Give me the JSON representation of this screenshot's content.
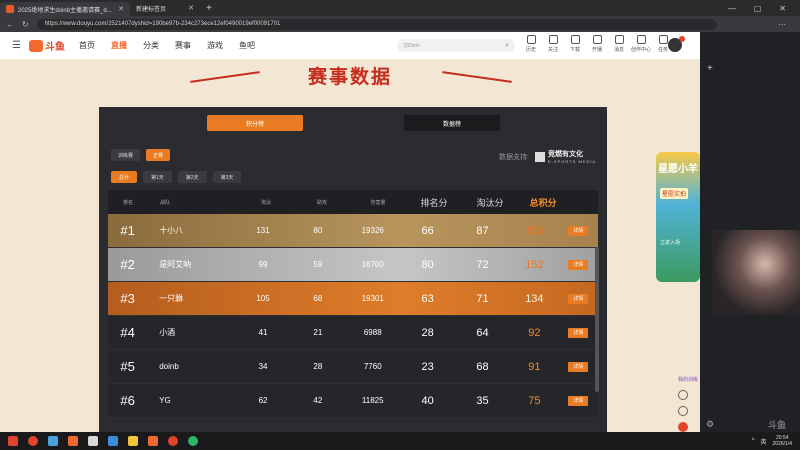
{
  "browser": {
    "tabs": [
      {
        "label": "2025绝地求生doinb主播邀请赛_d...",
        "active": true
      },
      {
        "label": "新建标签页",
        "active": false
      }
    ],
    "url": "https://www.douyu.com/2521407dyshid=190be97b-234c273ece12ef0490019ef00091701"
  },
  "site": {
    "logo": "斗鱼",
    "nav": [
      "首页",
      "直播",
      "分类",
      "赛事",
      "游戏",
      "鱼吧"
    ],
    "nav_active": "直播",
    "search_placeholder": "汉Dnon",
    "header_icons": [
      "历史",
      "关注",
      "下载",
      "开播",
      "消息",
      "创作中心",
      "任务"
    ]
  },
  "event": {
    "title": "赛事数据",
    "main_tabs": [
      "积分榜",
      "数据榜"
    ],
    "sub_tabs": [
      "训练赛",
      "正赛"
    ],
    "day_tabs": [
      "总计",
      "第1天",
      "第2天",
      "第3天"
    ],
    "sponsor_label": "数据支持:",
    "sponsor_brand": "竞燃有文化",
    "sponsor_sub": "E-SPORTS MEDIA"
  },
  "table": {
    "headers": [
      "排名",
      "战队",
      "淘汰",
      "助攻",
      "伤害量",
      "排名分",
      "淘汰分",
      "总积分"
    ],
    "detail_label": "详情",
    "rows": [
      {
        "rank": "#1",
        "team": "十小八",
        "kills": "131",
        "assists": "80",
        "damage": "19326",
        "place_pts": "66",
        "kill_pts": "87",
        "total": "153"
      },
      {
        "rank": "#2",
        "team": "是阿艾呐",
        "kills": "99",
        "assists": "59",
        "damage": "16700",
        "place_pts": "80",
        "kill_pts": "72",
        "total": "152"
      },
      {
        "rank": "#3",
        "team": "一只貅",
        "kills": "105",
        "assists": "68",
        "damage": "19301",
        "place_pts": "63",
        "kill_pts": "71",
        "total": "134"
      },
      {
        "rank": "#4",
        "team": "小酒",
        "kills": "41",
        "assists": "21",
        "damage": "6988",
        "place_pts": "28",
        "kill_pts": "64",
        "total": "92"
      },
      {
        "rank": "#5",
        "team": "doinb",
        "kills": "34",
        "assists": "28",
        "damage": "7760",
        "place_pts": "23",
        "kill_pts": "68",
        "total": "91"
      },
      {
        "rank": "#6",
        "team": "YG",
        "kills": "62",
        "assists": "42",
        "damage": "11825",
        "place_pts": "40",
        "kill_pts": "35",
        "total": "75"
      }
    ]
  },
  "promo": {
    "title": "星愿小羊",
    "badge": "星愿实拍",
    "cta": "立返入场"
  },
  "side_tag": "我的训练",
  "taskbar": {
    "time": "20:54",
    "date": "2026/1/4",
    "ime": "英"
  },
  "watermark": "斗鱼"
}
